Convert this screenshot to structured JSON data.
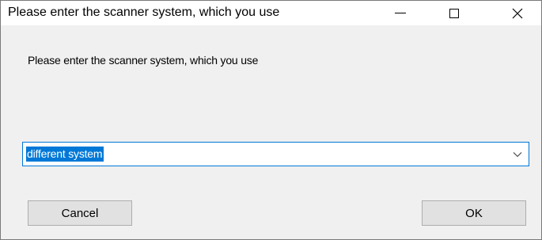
{
  "window": {
    "title": "Please enter the scanner system, which you use",
    "controls": {
      "minimize_icon": "minimize-icon",
      "maximize_icon": "maximize-icon",
      "close_icon": "close-icon"
    }
  },
  "dialog": {
    "prompt": "Please enter the scanner system, which you use",
    "scanner_select": {
      "selected_value": "different system",
      "dropdown_icon": "chevron-down-icon"
    },
    "buttons": {
      "cancel_label": "Cancel",
      "ok_label": "OK"
    }
  },
  "colors": {
    "accent": "#0078d7",
    "dialog_background": "#f0f0f0",
    "button_face": "#e1e1e1"
  }
}
